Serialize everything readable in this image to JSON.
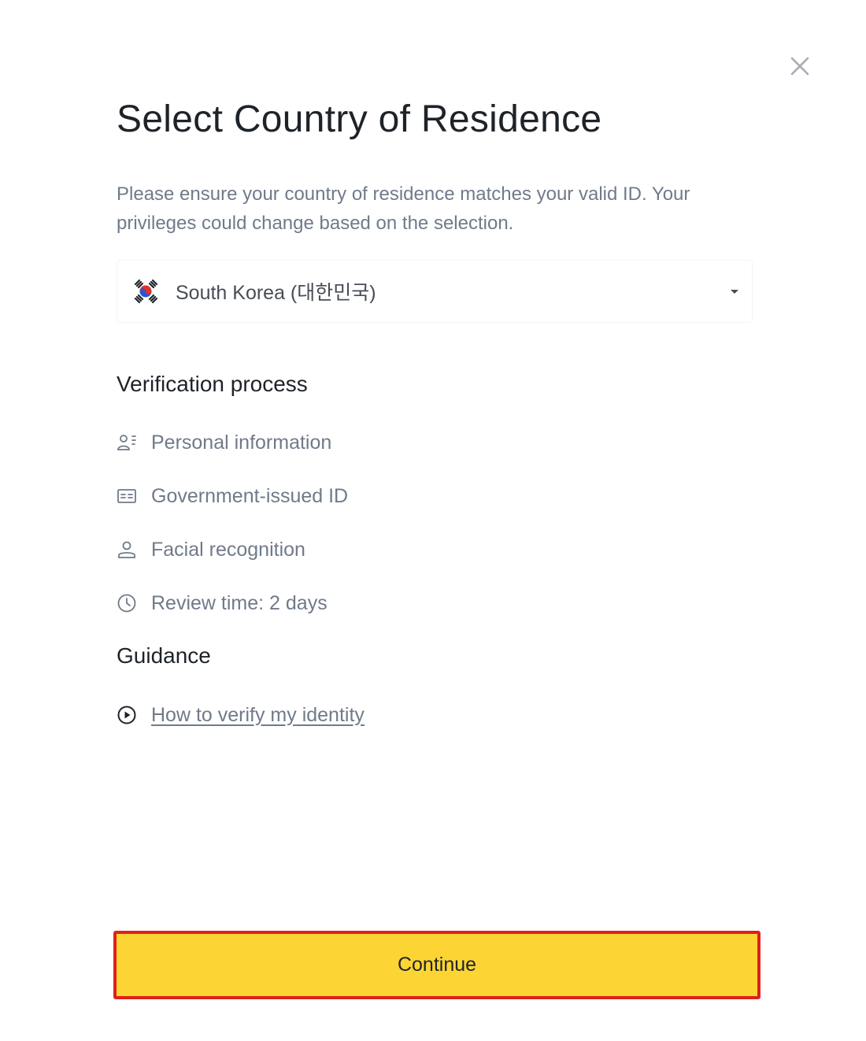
{
  "dialog": {
    "title": "Select Country of Residence",
    "description": "Please ensure your country of residence matches your valid ID. Your privileges could change based on the selection.",
    "close_icon": "close-icon"
  },
  "country_select": {
    "selected_value": "South Korea (대한민국)",
    "flag_icon": "south-korea-flag-icon",
    "dropdown_icon": "caret-down-icon"
  },
  "verification": {
    "heading": "Verification process",
    "steps": [
      {
        "label": "Personal information",
        "icon": "personal-info-icon"
      },
      {
        "label": "Government-issued ID",
        "icon": "id-card-icon"
      },
      {
        "label": "Facial recognition",
        "icon": "user-icon"
      },
      {
        "label": "Review time: 2 days",
        "icon": "clock-icon"
      }
    ]
  },
  "guidance": {
    "heading": "Guidance",
    "link_label": "How to verify my identity",
    "link_icon": "play-circle-icon"
  },
  "actions": {
    "continue_label": "Continue"
  },
  "colors": {
    "primary_button": "#fcd535",
    "highlight_border": "#e0201a",
    "text_primary": "#1e2329",
    "text_secondary": "#707a8a"
  }
}
